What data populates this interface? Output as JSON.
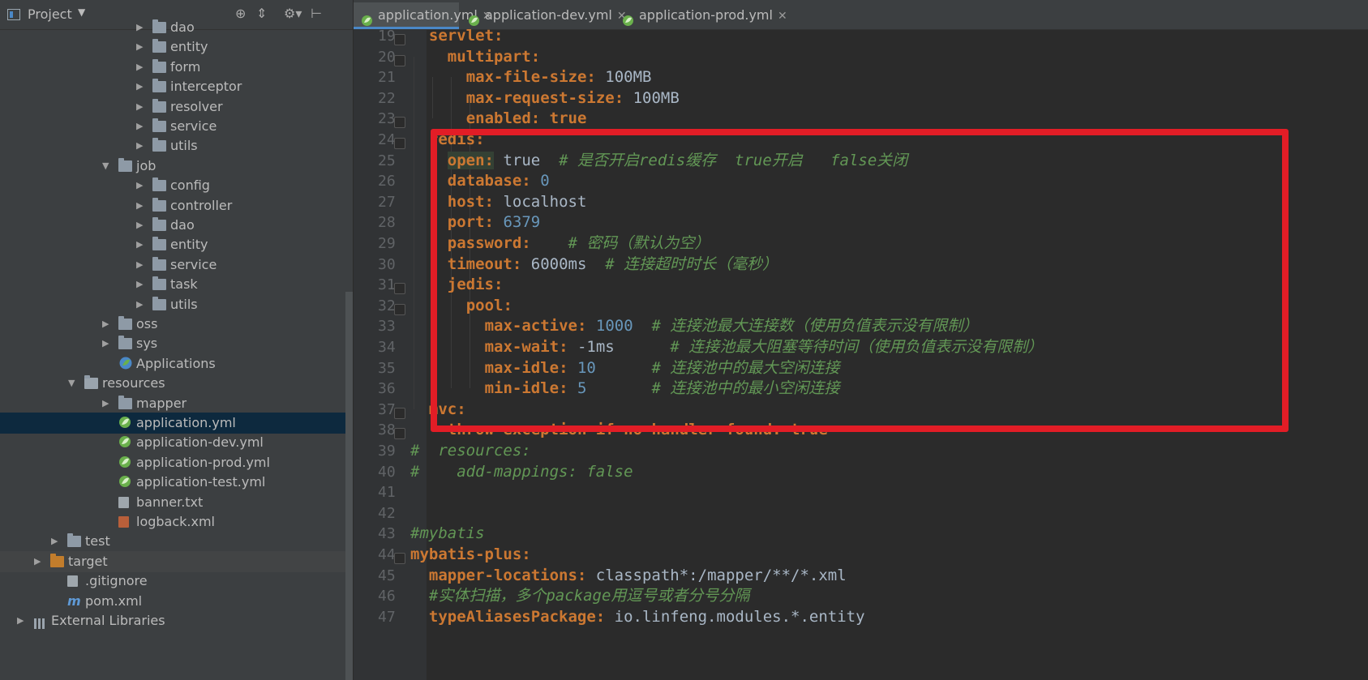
{
  "project_panel": {
    "title": "Project",
    "tree": [
      {
        "label": "dao",
        "depth": 3,
        "kind": "folder",
        "expanded": false
      },
      {
        "label": "entity",
        "depth": 3,
        "kind": "folder",
        "expanded": false
      },
      {
        "label": "form",
        "depth": 3,
        "kind": "folder",
        "expanded": false
      },
      {
        "label": "interceptor",
        "depth": 3,
        "kind": "folder",
        "expanded": false
      },
      {
        "label": "resolver",
        "depth": 3,
        "kind": "folder",
        "expanded": false
      },
      {
        "label": "service",
        "depth": 3,
        "kind": "folder",
        "expanded": false
      },
      {
        "label": "utils",
        "depth": 3,
        "kind": "folder",
        "expanded": false
      },
      {
        "label": "job",
        "depth": 2,
        "kind": "folder",
        "expanded": true
      },
      {
        "label": "config",
        "depth": 3,
        "kind": "folder",
        "expanded": false
      },
      {
        "label": "controller",
        "depth": 3,
        "kind": "folder",
        "expanded": false
      },
      {
        "label": "dao",
        "depth": 3,
        "kind": "folder",
        "expanded": false
      },
      {
        "label": "entity",
        "depth": 3,
        "kind": "folder",
        "expanded": false
      },
      {
        "label": "service",
        "depth": 3,
        "kind": "folder",
        "expanded": false
      },
      {
        "label": "task",
        "depth": 3,
        "kind": "folder",
        "expanded": false
      },
      {
        "label": "utils",
        "depth": 3,
        "kind": "folder",
        "expanded": false
      },
      {
        "label": "oss",
        "depth": 2,
        "kind": "folder",
        "expanded": false
      },
      {
        "label": "sys",
        "depth": 2,
        "kind": "folder",
        "expanded": false
      },
      {
        "label": "Applications",
        "depth": 2,
        "kind": "app",
        "expanded": null
      },
      {
        "label": "resources",
        "depth": 1,
        "kind": "res",
        "expanded": true
      },
      {
        "label": "mapper",
        "depth": 2,
        "kind": "folder",
        "expanded": false
      },
      {
        "label": "application.yml",
        "depth": 2,
        "kind": "spring",
        "expanded": null,
        "selected": true
      },
      {
        "label": "application-dev.yml",
        "depth": 2,
        "kind": "spring",
        "expanded": null
      },
      {
        "label": "application-prod.yml",
        "depth": 2,
        "kind": "spring",
        "expanded": null
      },
      {
        "label": "application-test.yml",
        "depth": 2,
        "kind": "spring",
        "expanded": null
      },
      {
        "label": "banner.txt",
        "depth": 2,
        "kind": "txt",
        "expanded": null
      },
      {
        "label": "logback.xml",
        "depth": 2,
        "kind": "xml",
        "expanded": null
      },
      {
        "label": "test",
        "depth": 0.5,
        "kind": "folder",
        "expanded": false
      },
      {
        "label": "target",
        "depth": 0,
        "kind": "orange",
        "expanded": false,
        "highlight": true
      },
      {
        "label": ".gitignore",
        "depth": 0.5,
        "kind": "txt",
        "expanded": null
      },
      {
        "label": "pom.xml",
        "depth": 0.5,
        "kind": "maven",
        "expanded": null
      },
      {
        "label": "External Libraries",
        "depth": -0.5,
        "kind": "lib",
        "expanded": false
      }
    ]
  },
  "tabs": [
    {
      "label": "application.yml",
      "active": true
    },
    {
      "label": "application-dev.yml",
      "active": false
    },
    {
      "label": "application-prod.yml",
      "active": false
    }
  ],
  "editor": {
    "lines": [
      {
        "n": "19",
        "indent": 1,
        "tokens": [
          {
            "t": "servlet:",
            "c": "k"
          }
        ]
      },
      {
        "n": "20",
        "indent": 2,
        "tokens": [
          {
            "t": "multipart:",
            "c": "k"
          }
        ]
      },
      {
        "n": "21",
        "indent": 3,
        "tokens": [
          {
            "t": "max-file-size: ",
            "c": "k"
          },
          {
            "t": "100MB",
            "c": "v"
          }
        ]
      },
      {
        "n": "22",
        "indent": 3,
        "tokens": [
          {
            "t": "max-request-size: ",
            "c": "k"
          },
          {
            "t": "100MB",
            "c": "v"
          }
        ]
      },
      {
        "n": "23",
        "indent": 3,
        "tokens": [
          {
            "t": "enabled: ",
            "c": "k"
          },
          {
            "t": "true",
            "c": "k"
          }
        ]
      },
      {
        "n": "24",
        "indent": 1,
        "tokens": [
          {
            "t": "redis:",
            "c": "k"
          }
        ]
      },
      {
        "n": "25",
        "indent": 2,
        "tokens": [
          {
            "t": "open:",
            "c": "k hl"
          },
          {
            "t": " true  ",
            "c": "v"
          },
          {
            "t": "# 是否开启redis缓存  true开启   false关闭",
            "c": "c"
          }
        ]
      },
      {
        "n": "26",
        "indent": 2,
        "tokens": [
          {
            "t": "database: ",
            "c": "k"
          },
          {
            "t": "0",
            "c": "n"
          }
        ]
      },
      {
        "n": "27",
        "indent": 2,
        "tokens": [
          {
            "t": "host: ",
            "c": "k"
          },
          {
            "t": "localhost",
            "c": "v"
          }
        ]
      },
      {
        "n": "28",
        "indent": 2,
        "tokens": [
          {
            "t": "port: ",
            "c": "k"
          },
          {
            "t": "6379",
            "c": "n"
          }
        ]
      },
      {
        "n": "29",
        "indent": 2,
        "tokens": [
          {
            "t": "password:    ",
            "c": "k"
          },
          {
            "t": "# 密码（默认为空）",
            "c": "c"
          }
        ]
      },
      {
        "n": "30",
        "indent": 2,
        "tokens": [
          {
            "t": "timeout: ",
            "c": "k"
          },
          {
            "t": "6000ms  ",
            "c": "v"
          },
          {
            "t": "# 连接超时时长（毫秒）",
            "c": "c"
          }
        ]
      },
      {
        "n": "31",
        "indent": 2,
        "tokens": [
          {
            "t": "jedis:",
            "c": "k"
          }
        ]
      },
      {
        "n": "32",
        "indent": 3,
        "tokens": [
          {
            "t": "pool:",
            "c": "k"
          }
        ]
      },
      {
        "n": "33",
        "indent": 4,
        "tokens": [
          {
            "t": "max-active: ",
            "c": "k"
          },
          {
            "t": "1000  ",
            "c": "n"
          },
          {
            "t": "# 连接池最大连接数（使用负值表示没有限制）",
            "c": "c"
          }
        ]
      },
      {
        "n": "34",
        "indent": 4,
        "tokens": [
          {
            "t": "max-wait: ",
            "c": "k"
          },
          {
            "t": "-1ms      ",
            "c": "v"
          },
          {
            "t": "# 连接池最大阻塞等待时间（使用负值表示没有限制）",
            "c": "c"
          }
        ]
      },
      {
        "n": "35",
        "indent": 4,
        "tokens": [
          {
            "t": "max-idle: ",
            "c": "k"
          },
          {
            "t": "10      ",
            "c": "n"
          },
          {
            "t": "# 连接池中的最大空闲连接",
            "c": "c"
          }
        ]
      },
      {
        "n": "36",
        "indent": 4,
        "tokens": [
          {
            "t": "min-idle: ",
            "c": "k"
          },
          {
            "t": "5       ",
            "c": "n"
          },
          {
            "t": "# 连接池中的最小空闲连接",
            "c": "c"
          }
        ]
      },
      {
        "n": "37",
        "indent": 1,
        "tokens": [
          {
            "t": "mvc:",
            "c": "k"
          }
        ]
      },
      {
        "n": "38",
        "indent": 2,
        "tokens": [
          {
            "t": "throw-exception-if-no-handler-found: ",
            "c": "k"
          },
          {
            "t": "true",
            "c": "k"
          }
        ]
      },
      {
        "n": "39",
        "indent": 0,
        "tokens": [
          {
            "t": "#  resources:",
            "c": "c"
          }
        ]
      },
      {
        "n": "40",
        "indent": 0,
        "tokens": [
          {
            "t": "#    add-mappings: false",
            "c": "c"
          }
        ]
      },
      {
        "n": "41",
        "indent": 0,
        "tokens": []
      },
      {
        "n": "42",
        "indent": 0,
        "tokens": []
      },
      {
        "n": "43",
        "indent": 0,
        "tokens": [
          {
            "t": "#mybatis",
            "c": "c"
          }
        ]
      },
      {
        "n": "44",
        "indent": 0,
        "tokens": [
          {
            "t": "mybatis-plus:",
            "c": "k"
          }
        ]
      },
      {
        "n": "45",
        "indent": 1,
        "tokens": [
          {
            "t": "mapper-locations: ",
            "c": "k"
          },
          {
            "t": "classpath*:/mapper/**/*.xml",
            "c": "v"
          }
        ]
      },
      {
        "n": "46",
        "indent": 1,
        "tokens": [
          {
            "t": "#实体扫描，多个package用逗号或者分号分隔",
            "c": "c"
          }
        ]
      },
      {
        "n": "47",
        "indent": 1,
        "tokens": [
          {
            "t": "typeAliasesPackage: ",
            "c": "k"
          },
          {
            "t": "io.linfeng.modules.*.entity",
            "c": "v"
          }
        ]
      }
    ]
  },
  "colors": {
    "keyword": "#cc7832",
    "value": "#a9b7c6",
    "number": "#6897bb",
    "comment": "#629755",
    "annotation_box": "#e21d26"
  }
}
